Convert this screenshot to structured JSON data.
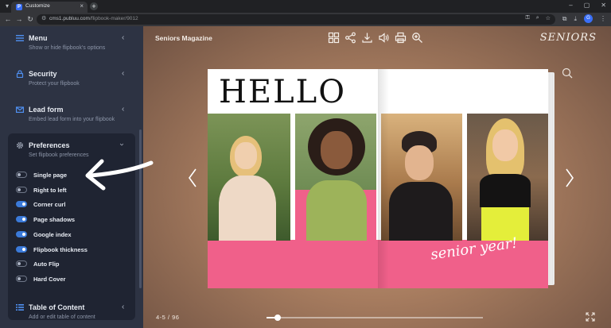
{
  "browser": {
    "tab_title": "Customize",
    "tab_favicon": "P",
    "url_host": "cms1.publuu.com",
    "url_path": "/flipbook-maker/9012",
    "profile_initial": "G"
  },
  "sidebar": {
    "sections": [
      {
        "title": "Menu",
        "subtitle": "Show or hide flipbook's options",
        "icon": "menu-icon"
      },
      {
        "title": "Security",
        "subtitle": "Protect your flipbook",
        "icon": "lock-icon"
      },
      {
        "title": "Lead form",
        "subtitle": "Embed lead form into your flipbook",
        "icon": "mail-icon"
      },
      {
        "title": "Preferences",
        "subtitle": "Set flipbook preferences",
        "icon": "gear-icon"
      },
      {
        "title": "Table of Content",
        "subtitle": "Add or edit table of content",
        "icon": "list-icon"
      }
    ],
    "preferences": [
      {
        "label": "Single page",
        "on": false
      },
      {
        "label": "Right to left",
        "on": false
      },
      {
        "label": "Corner curl",
        "on": true
      },
      {
        "label": "Page shadows",
        "on": true
      },
      {
        "label": "Google index",
        "on": true
      },
      {
        "label": "Flipbook thickness",
        "on": true
      },
      {
        "label": "Auto Flip",
        "on": false
      },
      {
        "label": "Hard Cover",
        "on": false
      }
    ]
  },
  "viewer": {
    "title": "Seniors Magazine",
    "logo": "SENIORS",
    "tools": [
      "grid-icon",
      "share-icon",
      "download-icon",
      "sound-icon",
      "print-icon",
      "zoom-icon"
    ],
    "page_indicator": "4-5 / 96",
    "progress": 0.05,
    "colors": {
      "accent_pink": "#f0608a"
    }
  },
  "book": {
    "heading": "HELLO",
    "script_text": "senior year!"
  }
}
